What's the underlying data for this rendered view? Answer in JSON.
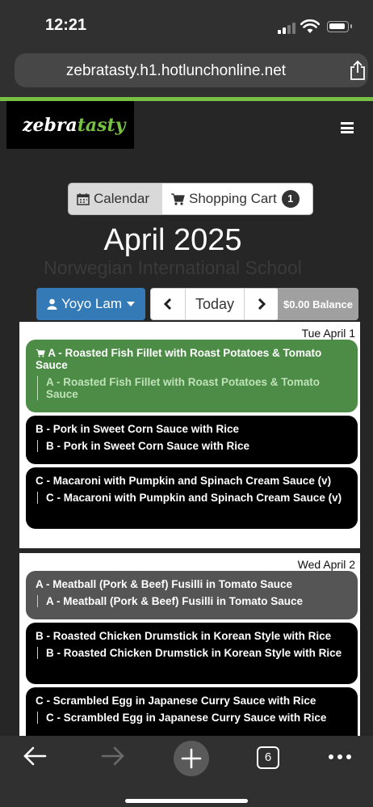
{
  "status": {
    "time": "12:21"
  },
  "browser": {
    "url": "zebratasty.h1.hotlunchonline.net",
    "tab_count": "6"
  },
  "brand": {
    "logo_part1": "zebra",
    "logo_part2": "tasty",
    "accent": "#76c043"
  },
  "tabs": {
    "calendar": "Calendar",
    "cart": "Shopping Cart",
    "cart_count": "1"
  },
  "heading": {
    "month": "April 2025",
    "school": "Norwegian International School"
  },
  "controls": {
    "user": "Yoyo Lam",
    "today": "Today",
    "balance": "$0.00 Balance"
  },
  "days": [
    {
      "date": "Tue April 1",
      "meals": [
        {
          "title": "A - Roasted Fish Fillet with Roast Potatoes & Tomato Sauce",
          "detail": "A - Roasted Fish Fillet with Roast Potatoes & Tomato Sauce",
          "state": "in-cart",
          "color": "#4c8c46"
        },
        {
          "title": "B - Pork in Sweet Corn Sauce with Rice",
          "detail": "B - Pork in Sweet Corn Sauce with Rice",
          "state": "available",
          "color": "#000000"
        },
        {
          "title": "C - Macaroni with Pumpkin and Spinach Cream Sauce (v)",
          "detail": "C - Macaroni with Pumpkin and Spinach Cream Sauce (v)",
          "state": "available",
          "color": "#000000"
        }
      ]
    },
    {
      "date": "Wed April 2",
      "meals": [
        {
          "title": "A - Meatball (Pork & Beef) Fusilli in Tomato Sauce",
          "detail": "A - Meatball (Pork & Beef) Fusilli in Tomato Sauce",
          "state": "unavailable",
          "color": "#555555"
        },
        {
          "title": "B - Roasted Chicken Drumstick in Korean Style with Rice",
          "detail": "B - Roasted Chicken Drumstick in Korean Style with Rice",
          "state": "available",
          "color": "#000000"
        },
        {
          "title": "C - Scrambled Egg in Japanese Curry Sauce with Rice",
          "detail": "C - Scrambled Egg in Japanese Curry Sauce with Rice",
          "state": "available",
          "color": "#000000"
        }
      ]
    }
  ]
}
